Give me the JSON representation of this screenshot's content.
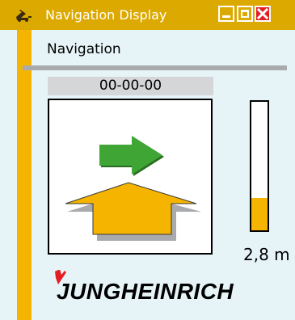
{
  "window": {
    "title": "Navigation Display",
    "app_icon": "forklift-icon",
    "buttons": {
      "minimize": "minimize-icon",
      "maximize": "maximize-icon",
      "close": "close-icon"
    }
  },
  "section": {
    "label": "Navigation"
  },
  "counter": {
    "value": "00-00-00"
  },
  "navigation": {
    "direction_icon": "arrow-right-icon",
    "forward_icon": "arrow-up-icon"
  },
  "gauge": {
    "fill_fraction": 0.25
  },
  "distance": {
    "value": "2,8 m"
  },
  "brand": {
    "name": "JUNGHEINRICH"
  },
  "colors": {
    "accent": "#f5b400",
    "titlebar": "#dca900",
    "close": "#e31e24",
    "arrow_green": "#3fa535",
    "divider": "#a8aaad",
    "background": "#e6f4f8",
    "brand_red": "#e31e24"
  }
}
